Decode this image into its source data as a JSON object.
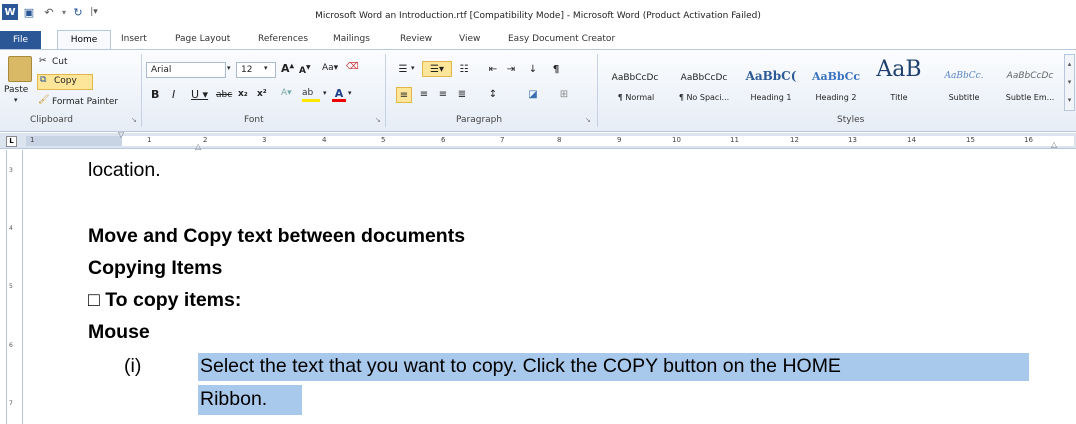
{
  "window": {
    "title": "Microsoft Word an Introduction.rtf [Compatibility Mode]  -  Microsoft Word (Product Activation Failed)"
  },
  "colors": {
    "file_tab": "#2b5797",
    "selection": "#a8c8ec",
    "ribbon_border": "#b7c8dd"
  },
  "quick_access": {
    "icons": [
      "word-icon",
      "save-icon",
      "undo-icon",
      "redo-icon",
      "customize-icon"
    ]
  },
  "tabs": [
    "File",
    "Home",
    "Insert",
    "Page Layout",
    "References",
    "Mailings",
    "Review",
    "View",
    "Easy Document Creator"
  ],
  "clipboard": {
    "paste": "Paste",
    "cut": "Cut",
    "copy": "Copy",
    "format_painter": "Format Painter",
    "label": "Clipboard"
  },
  "font": {
    "name": "Arial",
    "size": "12",
    "label": "Font"
  },
  "paragraph": {
    "label": "Paragraph"
  },
  "styles": {
    "label": "Styles",
    "items": [
      {
        "preview": "AaBbCcDc",
        "name": "¶ Normal"
      },
      {
        "preview": "AaBbCcDc",
        "name": "¶ No Spaci..."
      },
      {
        "preview": "AaBbC(",
        "name": "Heading 1"
      },
      {
        "preview": "AaBbCc",
        "name": "Heading 2"
      },
      {
        "preview": "AaB",
        "name": "Title"
      },
      {
        "preview": "AaBbCc.",
        "name": "Subtitle"
      },
      {
        "preview": "AaBbCcDc",
        "name": "Subtle Em..."
      }
    ]
  },
  "ruler": {
    "numbers": [
      "1",
      "1",
      "2",
      "3",
      "4",
      "5",
      "6",
      "7",
      "8",
      "9",
      "10",
      "11",
      "12",
      "13",
      "14",
      "15",
      "16"
    ]
  },
  "vruler": {
    "numbers": [
      "3",
      "4",
      "5",
      "6",
      "7"
    ]
  },
  "document": {
    "line1": "location.",
    "heading1": "Move and Copy text between documents",
    "heading2": "Copying Items",
    "heading3": "□ To copy items:",
    "heading4": "Mouse",
    "item_marker": "(i)",
    "item_line1": "Select the text that you want to copy. Click the COPY button on the HOME",
    "item_line2": "Ribbon."
  }
}
